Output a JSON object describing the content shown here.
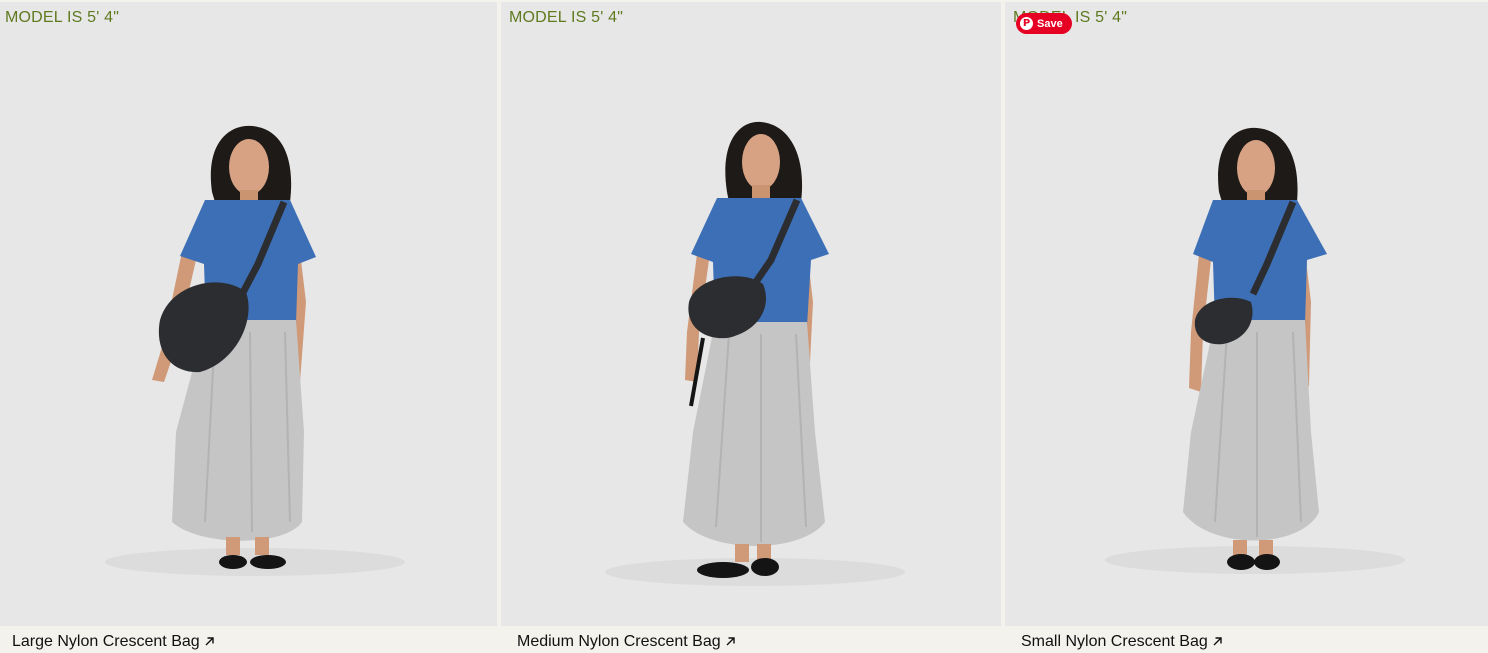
{
  "products": [
    {
      "height_note": "MODEL IS 5' 4\"",
      "name": "Large Nylon Crescent Bag",
      "bag_size": "large"
    },
    {
      "height_note": "MODEL IS 5' 4\"",
      "name": "Medium Nylon Crescent Bag",
      "bag_size": "medium"
    },
    {
      "height_note": "MODEL IS 5' 4\"",
      "name": "Small Nylon Crescent Bag",
      "bag_size": "small"
    }
  ],
  "pin_save": {
    "label": "Save",
    "icon": "pinterest-icon"
  },
  "link_icon": "arrow-up-right-icon",
  "colors": {
    "background": "#e7e7e7",
    "caption_bar": "#f3f2ed",
    "height_label": "#5f7a1f",
    "shirt": "#3d6fb6",
    "skirt": "#c4c5c4",
    "bag": "#2b2d30",
    "pinterest": "#e60023"
  }
}
